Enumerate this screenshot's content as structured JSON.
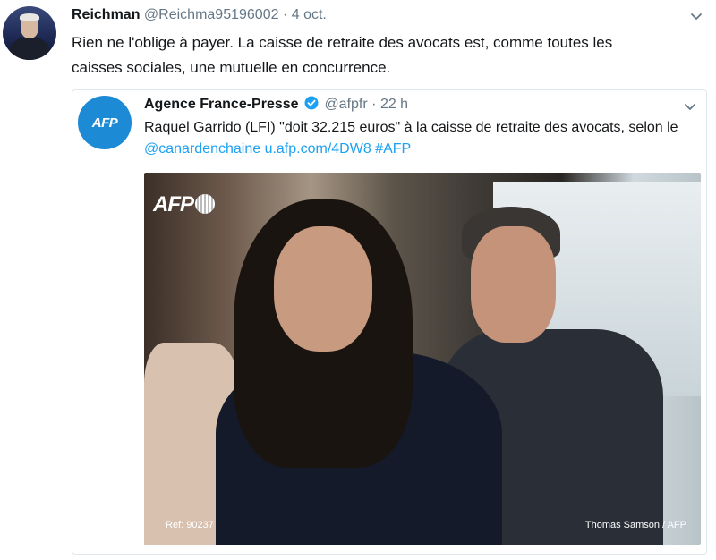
{
  "tweet": {
    "author_name": "Reichman",
    "author_handle": "@Reichma95196002",
    "separator": "·",
    "date": "4 oct.",
    "text_line1": "Rien ne l'oblige à payer. La caisse de retraite des avocats est, comme toutes les",
    "text_line2": "caisses sociales, une mutuelle en concurrence."
  },
  "quoted": {
    "author_name": "Agence France-Presse",
    "author_handle": "@afpfr",
    "separator": "·",
    "date": "22 h",
    "avatar_label": "AFP",
    "text_line1": "Raquel Garrido (LFI) \"doit 32.215 euros\" à la caisse de retraite des avocats, selon le",
    "mention": "@canardenchaine",
    "url": "u.afp.com/4DW8",
    "hashtag": "#AFP",
    "photo": {
      "logo": "AFP",
      "ref": "Ref: 90237",
      "credit": "Thomas Samson / AFP"
    }
  },
  "colors": {
    "link": "#1da1f2",
    "secondary_text": "#657786",
    "afp_blue": "#1d8ad6"
  },
  "icons": [
    "chevron-down-icon",
    "verified-badge-icon"
  ]
}
